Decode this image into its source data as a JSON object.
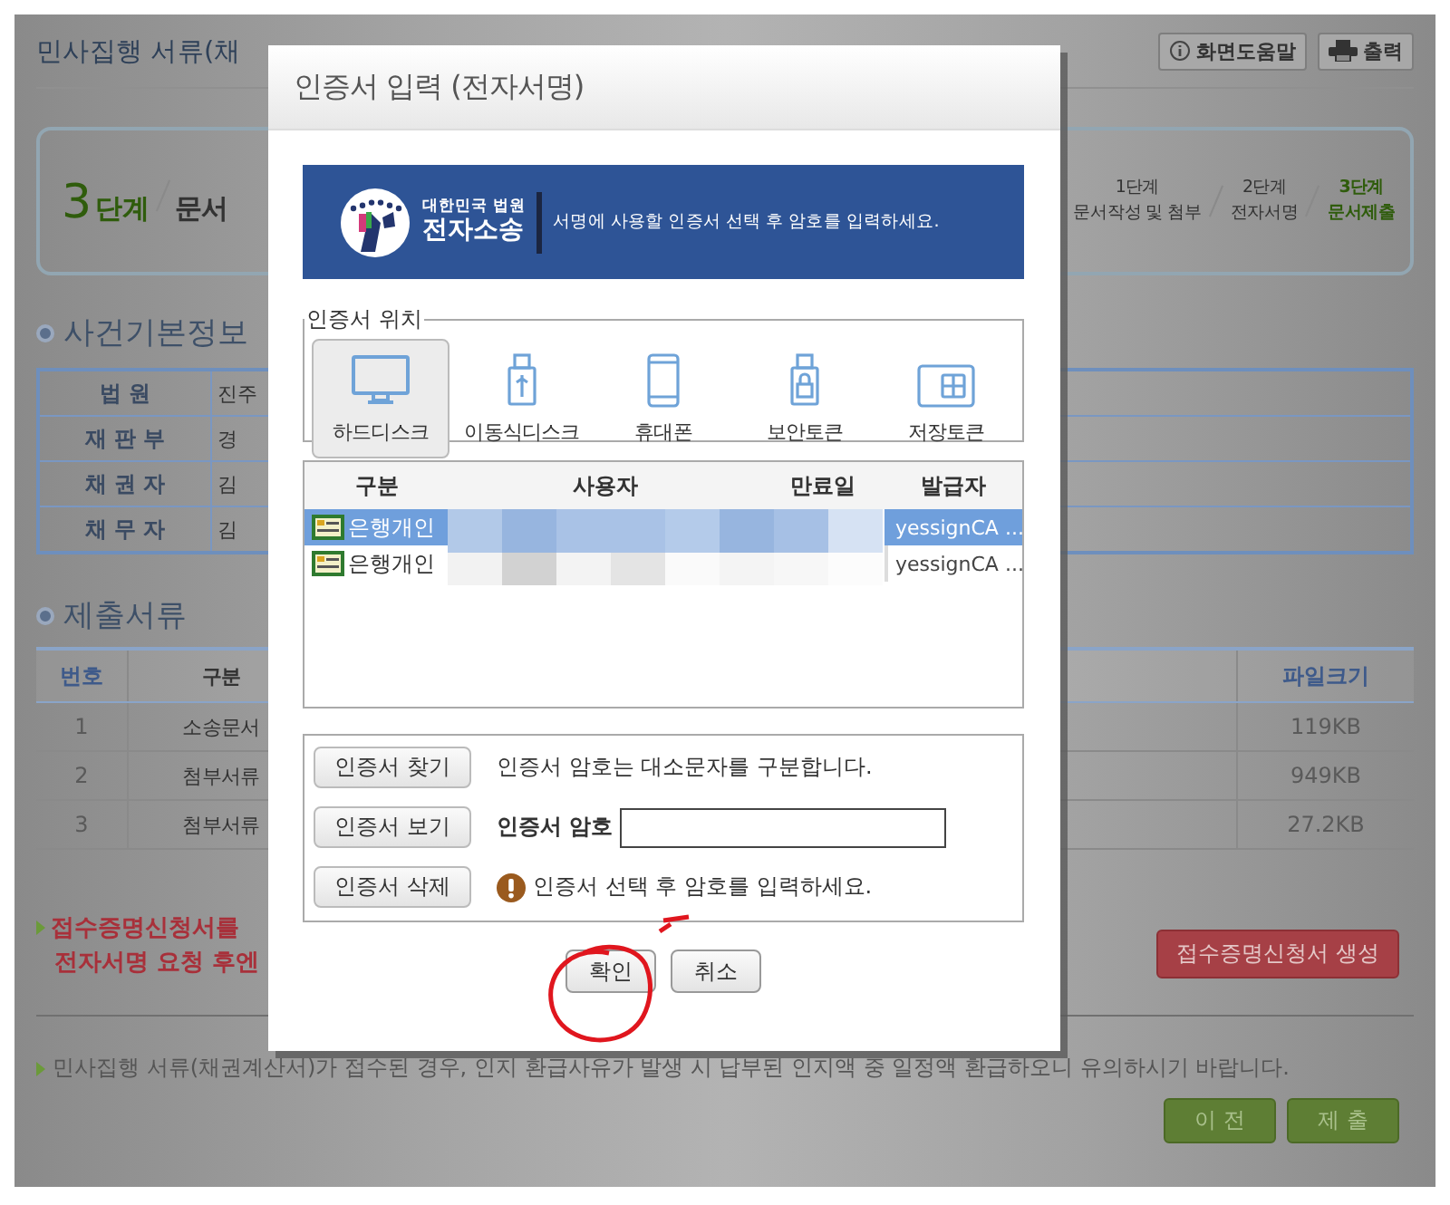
{
  "page": {
    "title": "민사집행 서류(채",
    "help_button": "화면도움말",
    "print_button": "출력",
    "steps": {
      "current_number": "3",
      "current_unit": "단계",
      "current_name": "문서",
      "items": [
        {
          "step": "1단계",
          "name": "문서작성 및 첨부",
          "selected": false
        },
        {
          "step": "2단계",
          "name": "전자서명",
          "selected": false
        },
        {
          "step": "3단계",
          "name": "문서제출",
          "selected": true
        }
      ]
    },
    "case_info": {
      "heading": "사건기본정보",
      "rows": [
        {
          "label": "법 원",
          "value": "진주"
        },
        {
          "label": "재 판 부",
          "value": "경"
        },
        {
          "label": "채 권 자",
          "value": "김"
        },
        {
          "label": "채 무 자",
          "value": "김"
        }
      ]
    },
    "documents": {
      "heading": "제출서류",
      "columns": [
        "번호",
        "구분",
        "파일크기"
      ],
      "rows": [
        {
          "no": "1",
          "type": "소송문서",
          "size": "119KB"
        },
        {
          "no": "2",
          "type": "첨부서류",
          "size": "949KB"
        },
        {
          "no": "3",
          "type": "첨부서류",
          "size": "27.2KB"
        }
      ]
    },
    "notes": [
      "접수증명신청서를",
      "전자서명 요청 후엔"
    ],
    "receipt_button": "접수증명신청서 생성",
    "footer_note": "민사집행 서류(채권계산서)가 접수된 경우, 인지 환급사유가 발생 시 납부된 인지액 중 일정액 환급하오니 유의하시기 바랍니다.",
    "buttons": [
      "이 전",
      "제 출"
    ]
  },
  "dialog": {
    "title": "인증서 입력 (전자서명)",
    "banner": {
      "org": "대한민국 법원",
      "brand": "전자소송",
      "message": "서명에 사용할 인증서 선택 후 암호를 입력하세요."
    },
    "location": {
      "legend": "인증서 위치",
      "items": [
        {
          "kind": "harddisk",
          "label": "하드디스크",
          "selected": true
        },
        {
          "kind": "usb",
          "label": "이동식디스크",
          "selected": false
        },
        {
          "kind": "phone",
          "label": "휴대폰",
          "selected": false
        },
        {
          "kind": "token",
          "label": "보안토큰",
          "selected": false
        },
        {
          "kind": "storage",
          "label": "저장토큰",
          "selected": false
        }
      ]
    },
    "certificates": {
      "columns": [
        "구분",
        "사용자",
        "만료일",
        "발급자"
      ],
      "rows": [
        {
          "type": "은행개인",
          "issuer": "yessignCA ...",
          "selected": true
        },
        {
          "type": "은행개인",
          "issuer": "yessignCA ...",
          "selected": false
        }
      ]
    },
    "actions": [
      "인증서 찾기",
      "인증서 보기",
      "인증서 삭제"
    ],
    "hint": "인증서 암호는 대소문자를 구분합니다.",
    "password_label": "인증서 암호",
    "warning": "인증서 선택 후 암호를 입력하세요.",
    "buttons": [
      "확인",
      "취소"
    ]
  }
}
